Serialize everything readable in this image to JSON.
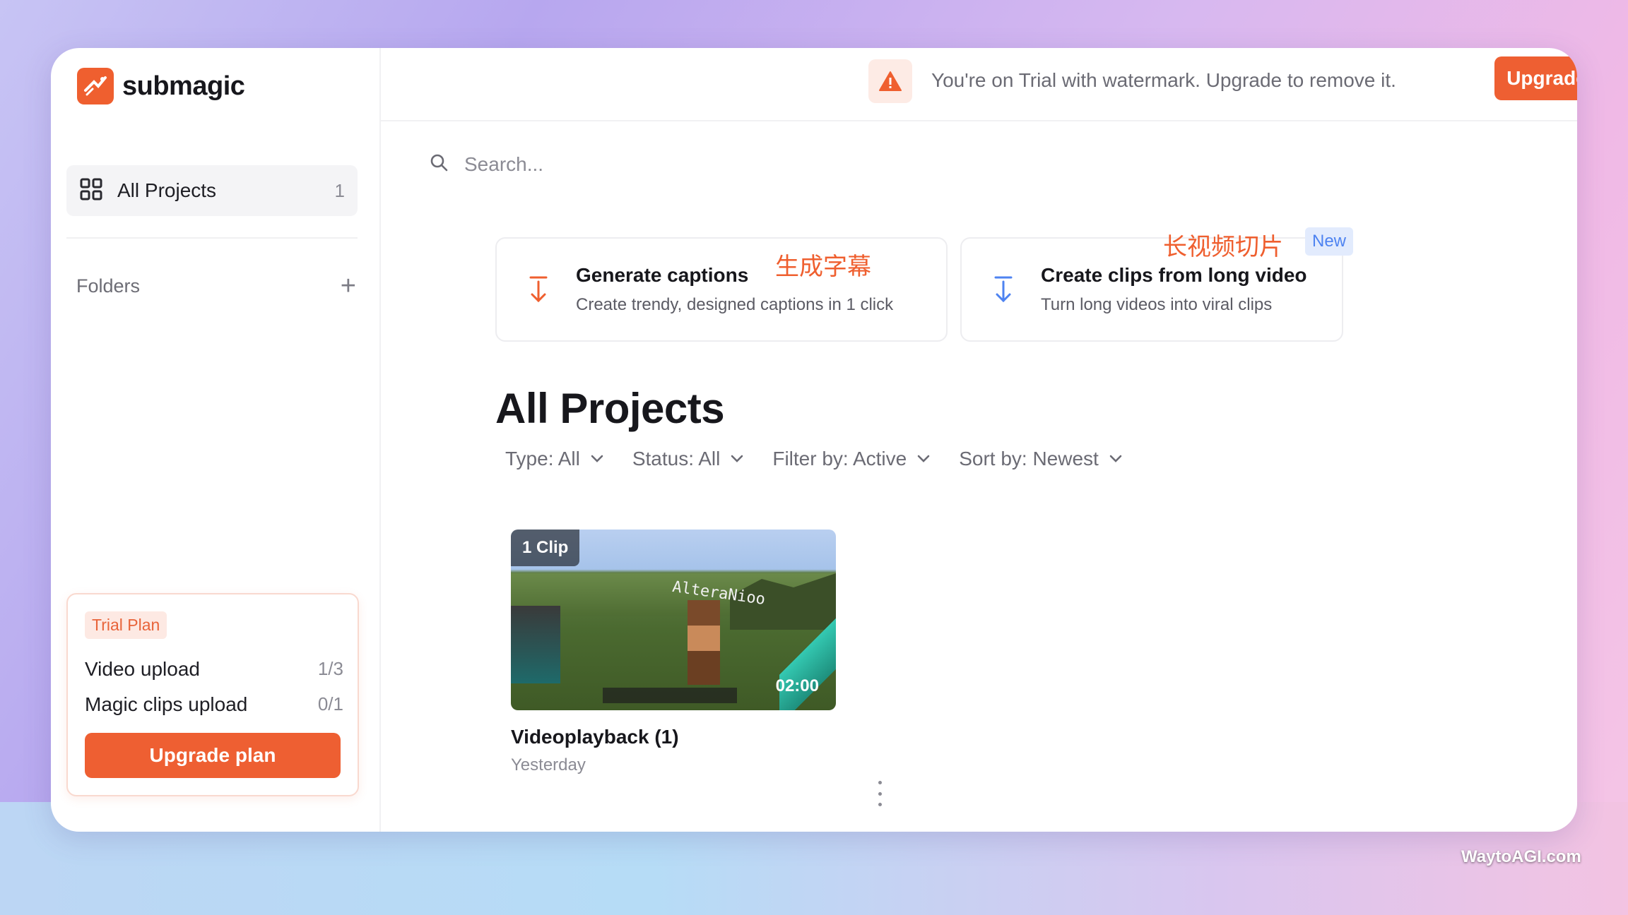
{
  "brand": {
    "name": "submagic",
    "accent": "#ef5f2f",
    "blue_accent": "#4e83f1"
  },
  "sidebar": {
    "all_projects": {
      "label": "All Projects",
      "count": "1"
    },
    "folders_label": "Folders",
    "trial": {
      "badge": "Trial Plan",
      "rows": [
        {
          "label": "Video upload",
          "value": "1/3"
        },
        {
          "label": "Magic clips upload",
          "value": "0/1"
        }
      ],
      "button": "Upgrade plan"
    }
  },
  "topbar": {
    "message": "You're on Trial with watermark. Upgrade to remove it.",
    "button": "Upgrade"
  },
  "search": {
    "placeholder": "Search..."
  },
  "features": [
    {
      "title": "Generate captions",
      "subtitle": "Create trendy, designed captions in 1 click",
      "annotation": "生成字幕"
    },
    {
      "title": "Create clips from long video",
      "subtitle": "Turn long videos into viral clips",
      "annotation": "长视频切片",
      "badge": "New"
    }
  ],
  "main": {
    "title": "All Projects",
    "filters": [
      {
        "label": "Type: All"
      },
      {
        "label": "Status: All"
      },
      {
        "label": "Filter by: Active"
      },
      {
        "label": "Sort by: Newest"
      }
    ]
  },
  "projects": [
    {
      "title": "Videoplayback (1)",
      "date": "Yesterday",
      "clip_badge": "1 Clip",
      "duration": "02:00",
      "overlay_name": "AlteraNioo"
    }
  ],
  "watermark": "WaytoAGI.com"
}
